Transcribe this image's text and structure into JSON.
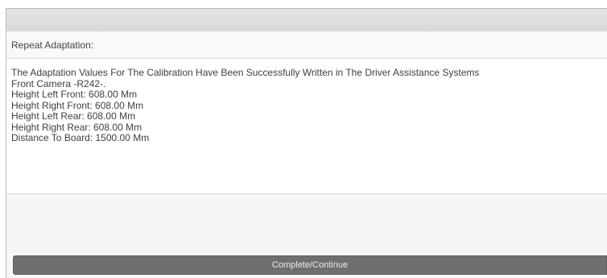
{
  "header": {
    "label": "Repeat Adaptation:"
  },
  "message": {
    "lines": [
      "The Adaptation Values For The Calibration Have Been Successfully Written in The Driver Assistance Systems",
      "Front Camera -R242-.",
      "Height Left Front: 608.00 Mm",
      "Height Right Front: 608.00 Mm",
      "Height Left Rear: 608.00 Mm",
      "Height Right Rear: 608.00 Mm",
      "Distance To Board: 1500.00 Mm"
    ]
  },
  "footer": {
    "button_label": "Complete/Continue"
  }
}
